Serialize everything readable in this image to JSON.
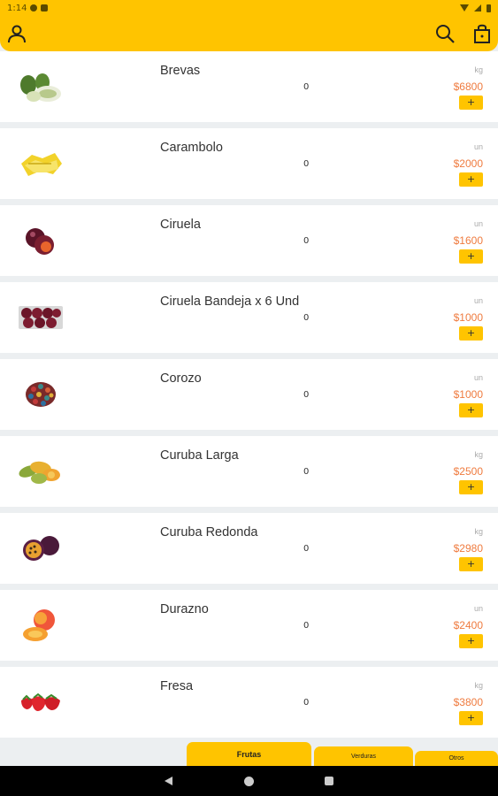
{
  "status_bar": {
    "time": "1:14"
  },
  "colors": {
    "accent": "#ffc400",
    "price": "#ef7b3f"
  },
  "app_bar": {
    "left_icon": "user-icon",
    "right_icons": [
      "search-icon",
      "cart-icon"
    ]
  },
  "products": [
    {
      "name": "Brevas",
      "qty": "0",
      "unit": "kg",
      "price": "$6800",
      "add_label": "+",
      "image": "figs"
    },
    {
      "name": "Carambolo",
      "qty": "0",
      "unit": "un",
      "price": "$2000",
      "add_label": "+",
      "image": "starfruit"
    },
    {
      "name": "Ciruela",
      "qty": "0",
      "unit": "un",
      "price": "$1600",
      "add_label": "+",
      "image": "plum"
    },
    {
      "name": "Ciruela Bandeja x 6 Und",
      "qty": "0",
      "unit": "un",
      "price": "$1000",
      "add_label": "+",
      "image": "plum-tray"
    },
    {
      "name": "Corozo",
      "qty": "0",
      "unit": "un",
      "price": "$1000",
      "add_label": "+",
      "image": "corozo"
    },
    {
      "name": "Curuba Larga",
      "qty": "0",
      "unit": "kg",
      "price": "$2500",
      "add_label": "+",
      "image": "curuba"
    },
    {
      "name": "Curuba Redonda",
      "qty": "0",
      "unit": "kg",
      "price": "$2980",
      "add_label": "+",
      "image": "passionfruit"
    },
    {
      "name": "Durazno",
      "qty": "0",
      "unit": "un",
      "price": "$2400",
      "add_label": "+",
      "image": "peach"
    },
    {
      "name": "Fresa",
      "qty": "0",
      "unit": "kg",
      "price": "$3800",
      "add_label": "+",
      "image": "strawberry"
    }
  ],
  "tabs": [
    {
      "label": "Frutas",
      "active": true
    },
    {
      "label": "Verduras",
      "active": false
    },
    {
      "label": "Otros",
      "active": false
    }
  ]
}
